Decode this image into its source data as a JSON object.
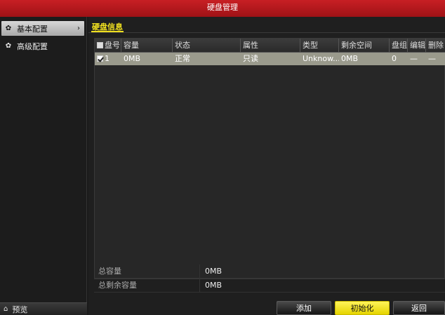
{
  "window": {
    "title": "硬盘管理"
  },
  "sidebar": {
    "items": [
      {
        "label": "基本配置",
        "icon": "gear-icon",
        "active": true
      },
      {
        "label": "高级配置",
        "icon": "gear-icon",
        "active": false
      }
    ],
    "bottom": {
      "label": "预览",
      "icon": "home-icon"
    }
  },
  "tab": {
    "label": "硬盘信息"
  },
  "table": {
    "columns": [
      "盘号",
      "容量",
      "状态",
      "属性",
      "类型",
      "剩余空间",
      "盘组",
      "编辑",
      "删除"
    ],
    "rows": [
      {
        "number": "1",
        "capacity": "0MB",
        "status": "正常",
        "attribute": "只读",
        "type": "Unknow...",
        "free": "0MB",
        "group": "0",
        "edit": "—",
        "delete": "—",
        "checked": true
      }
    ]
  },
  "summary": {
    "total_label": "总容量",
    "total_value": "0MB",
    "free_label": "总剩余容量",
    "free_value": "0MB"
  },
  "buttons": {
    "add": "添加",
    "init": "初始化",
    "back": "返回"
  },
  "colors": {
    "titlebar": "#b8191d",
    "accent": "#f0e020"
  }
}
